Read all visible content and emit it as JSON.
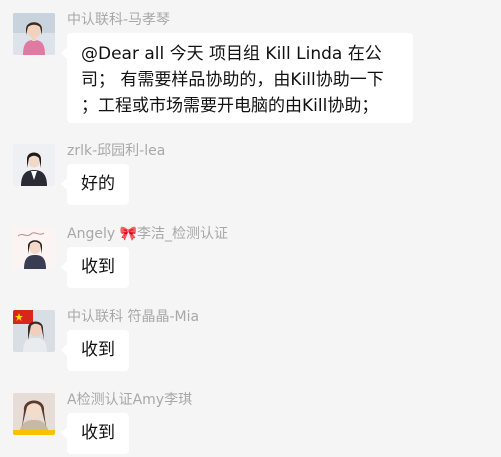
{
  "messages": [
    {
      "sender": "中认联科-马孝琴",
      "text_lines": [
        "@Dear all 今天 项目组 Kill  Linda 在公",
        "司；  有需要样品协助的，由Kill协助一下",
        "；工程或市场需要开电脑的由Kill协助；"
      ]
    },
    {
      "sender": "zrlk-邱园利-lea",
      "text": "好的"
    },
    {
      "sender_prefix": "Angely",
      "sender_emoji": "🎀",
      "sender_suffix": "李洁_检测认证",
      "text": "收到"
    },
    {
      "sender": "中认联科 符晶晶-Mia",
      "text": "收到"
    },
    {
      "sender": "A检测认证Amy李琪",
      "text": "收到"
    }
  ],
  "avatars": {
    "a1": "woman-portrait-pink-avatar",
    "a2": "woman-portrait-dark-suit-avatar",
    "a3": "woman-sample-sketch-avatar",
    "a4": "china-flag-portrait-avatar",
    "a5": "girl-portrait-avatar"
  }
}
